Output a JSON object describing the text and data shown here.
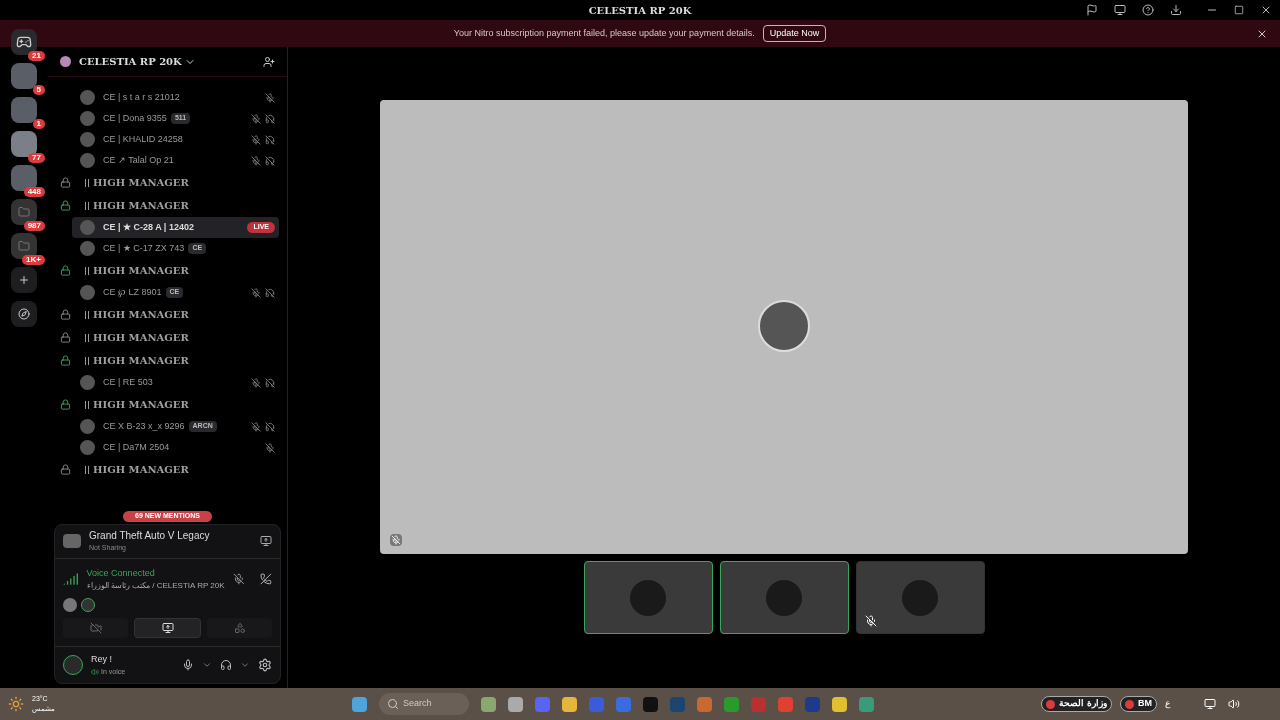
{
  "window": {
    "title": "CELESTIA RP 20K"
  },
  "banner": {
    "message": "Your Nitro subscription payment failed, please update your payment details.",
    "button": "Update Now"
  },
  "rail": {
    "home_badge": "21",
    "servers": [
      {
        "kind": "server",
        "badge": "5",
        "selected": false
      },
      {
        "kind": "server",
        "badge": "1",
        "selected": false
      },
      {
        "kind": "server",
        "badge": "77",
        "selected": true
      },
      {
        "kind": "server",
        "badge": "448",
        "selected": false
      },
      {
        "kind": "folder",
        "badge": "987",
        "selected": false
      },
      {
        "kind": "folder",
        "badge": "1K+",
        "selected": false
      }
    ]
  },
  "server": {
    "name": "CELESTIA RP 20K"
  },
  "channel_list": [
    {
      "kind": "member",
      "name": "CE | s t a r s 21012",
      "muted": true,
      "deafened": false,
      "selected": false
    },
    {
      "kind": "member",
      "name": "CE | Dona 9355",
      "tag": "511",
      "muted": true,
      "deafened": true,
      "selected": false
    },
    {
      "kind": "member",
      "name": "CE | KHALID 24258",
      "muted": true,
      "deafened": true,
      "selected": false
    },
    {
      "kind": "member",
      "name": "CE ↗ Talal Op 21",
      "muted": true,
      "deafened": true,
      "selected": false
    },
    {
      "kind": "channel",
      "name": "HIGH MANAGER",
      "unlocked": false
    },
    {
      "kind": "channel",
      "name": "HIGH MANAGER",
      "unlocked": true
    },
    {
      "kind": "member",
      "name": "CE | ★ C-28 A | 12402",
      "live_badge": "LIVE",
      "muted": false,
      "deafened": false,
      "selected": true
    },
    {
      "kind": "member",
      "name": "CE | ★ C-17 ZX 743",
      "tag": "CE",
      "muted": false,
      "deafened": false,
      "selected": false
    },
    {
      "kind": "channel",
      "name": "HIGH MANAGER",
      "unlocked": true
    },
    {
      "kind": "member",
      "name": "CE ℘ LZ 8901",
      "tag": "CE",
      "muted": true,
      "deafened": true,
      "selected": false
    },
    {
      "kind": "channel",
      "name": "HIGH MANAGER",
      "unlocked": false
    },
    {
      "kind": "channel",
      "name": "HIGH MANAGER",
      "unlocked": false
    },
    {
      "kind": "channel",
      "name": "HIGH MANAGER",
      "unlocked": true
    },
    {
      "kind": "member",
      "name": "CE | RE 503",
      "muted": true,
      "deafened": true,
      "selected": false
    },
    {
      "kind": "channel",
      "name": "HIGH MANAGER",
      "unlocked": true
    },
    {
      "kind": "member",
      "name": "CE X B-23 x_x 9296",
      "tag": "ARCN",
      "muted": true,
      "deafened": true,
      "selected": false
    },
    {
      "kind": "member",
      "name": "CE | Da7M 2504",
      "muted": true,
      "deafened": false,
      "selected": false
    },
    {
      "kind": "channel",
      "name": "HIGH MANAGER",
      "unlocked": false
    }
  ],
  "mentions_pill": "69 NEW MENTIONS",
  "activity": {
    "game": "Grand Theft Auto V Legacy",
    "status": "Not Sharing"
  },
  "voice": {
    "status": "Voice Connected",
    "channel": "مكتب رئاسة الوزراء / CELESTIA RP 20K"
  },
  "voice_tabs": [
    {
      "kind": "camera",
      "selected": false
    },
    {
      "kind": "screen",
      "selected": true
    },
    {
      "kind": "activities",
      "selected": false
    }
  ],
  "user": {
    "name": "Rey !",
    "status": "In voice"
  },
  "stage": {
    "muted": true
  },
  "thumbnails": [
    {
      "speaking": true,
      "muted": false
    },
    {
      "speaking": true,
      "muted": false
    },
    {
      "speaking": false,
      "muted": true
    }
  ],
  "taskbar": {
    "temperature": "23°C",
    "weather": "مشمس",
    "search_placeholder": "Search",
    "tray_pills": [
      "وزارة الصحة",
      "BM"
    ],
    "input_language": "ع"
  }
}
